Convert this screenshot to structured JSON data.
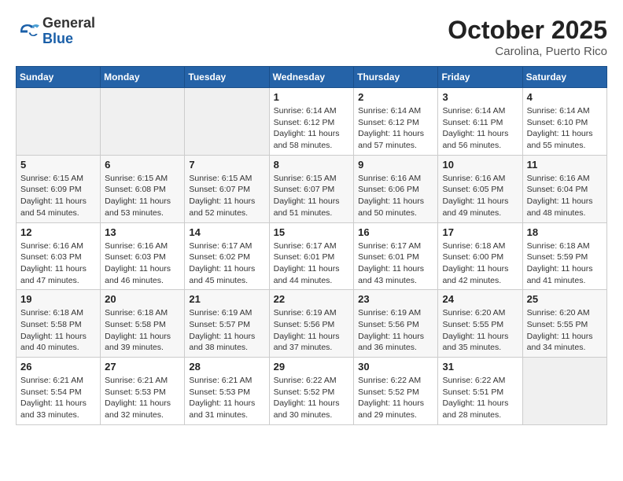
{
  "header": {
    "logo_general": "General",
    "logo_blue": "Blue",
    "month_title": "October 2025",
    "subtitle": "Carolina, Puerto Rico"
  },
  "days_of_week": [
    "Sunday",
    "Monday",
    "Tuesday",
    "Wednesday",
    "Thursday",
    "Friday",
    "Saturday"
  ],
  "weeks": [
    [
      {
        "day": "",
        "info": ""
      },
      {
        "day": "",
        "info": ""
      },
      {
        "day": "",
        "info": ""
      },
      {
        "day": "1",
        "info": "Sunrise: 6:14 AM\nSunset: 6:12 PM\nDaylight: 11 hours\nand 58 minutes."
      },
      {
        "day": "2",
        "info": "Sunrise: 6:14 AM\nSunset: 6:12 PM\nDaylight: 11 hours\nand 57 minutes."
      },
      {
        "day": "3",
        "info": "Sunrise: 6:14 AM\nSunset: 6:11 PM\nDaylight: 11 hours\nand 56 minutes."
      },
      {
        "day": "4",
        "info": "Sunrise: 6:14 AM\nSunset: 6:10 PM\nDaylight: 11 hours\nand 55 minutes."
      }
    ],
    [
      {
        "day": "5",
        "info": "Sunrise: 6:15 AM\nSunset: 6:09 PM\nDaylight: 11 hours\nand 54 minutes."
      },
      {
        "day": "6",
        "info": "Sunrise: 6:15 AM\nSunset: 6:08 PM\nDaylight: 11 hours\nand 53 minutes."
      },
      {
        "day": "7",
        "info": "Sunrise: 6:15 AM\nSunset: 6:07 PM\nDaylight: 11 hours\nand 52 minutes."
      },
      {
        "day": "8",
        "info": "Sunrise: 6:15 AM\nSunset: 6:07 PM\nDaylight: 11 hours\nand 51 minutes."
      },
      {
        "day": "9",
        "info": "Sunrise: 6:16 AM\nSunset: 6:06 PM\nDaylight: 11 hours\nand 50 minutes."
      },
      {
        "day": "10",
        "info": "Sunrise: 6:16 AM\nSunset: 6:05 PM\nDaylight: 11 hours\nand 49 minutes."
      },
      {
        "day": "11",
        "info": "Sunrise: 6:16 AM\nSunset: 6:04 PM\nDaylight: 11 hours\nand 48 minutes."
      }
    ],
    [
      {
        "day": "12",
        "info": "Sunrise: 6:16 AM\nSunset: 6:03 PM\nDaylight: 11 hours\nand 47 minutes."
      },
      {
        "day": "13",
        "info": "Sunrise: 6:16 AM\nSunset: 6:03 PM\nDaylight: 11 hours\nand 46 minutes."
      },
      {
        "day": "14",
        "info": "Sunrise: 6:17 AM\nSunset: 6:02 PM\nDaylight: 11 hours\nand 45 minutes."
      },
      {
        "day": "15",
        "info": "Sunrise: 6:17 AM\nSunset: 6:01 PM\nDaylight: 11 hours\nand 44 minutes."
      },
      {
        "day": "16",
        "info": "Sunrise: 6:17 AM\nSunset: 6:01 PM\nDaylight: 11 hours\nand 43 minutes."
      },
      {
        "day": "17",
        "info": "Sunrise: 6:18 AM\nSunset: 6:00 PM\nDaylight: 11 hours\nand 42 minutes."
      },
      {
        "day": "18",
        "info": "Sunrise: 6:18 AM\nSunset: 5:59 PM\nDaylight: 11 hours\nand 41 minutes."
      }
    ],
    [
      {
        "day": "19",
        "info": "Sunrise: 6:18 AM\nSunset: 5:58 PM\nDaylight: 11 hours\nand 40 minutes."
      },
      {
        "day": "20",
        "info": "Sunrise: 6:18 AM\nSunset: 5:58 PM\nDaylight: 11 hours\nand 39 minutes."
      },
      {
        "day": "21",
        "info": "Sunrise: 6:19 AM\nSunset: 5:57 PM\nDaylight: 11 hours\nand 38 minutes."
      },
      {
        "day": "22",
        "info": "Sunrise: 6:19 AM\nSunset: 5:56 PM\nDaylight: 11 hours\nand 37 minutes."
      },
      {
        "day": "23",
        "info": "Sunrise: 6:19 AM\nSunset: 5:56 PM\nDaylight: 11 hours\nand 36 minutes."
      },
      {
        "day": "24",
        "info": "Sunrise: 6:20 AM\nSunset: 5:55 PM\nDaylight: 11 hours\nand 35 minutes."
      },
      {
        "day": "25",
        "info": "Sunrise: 6:20 AM\nSunset: 5:55 PM\nDaylight: 11 hours\nand 34 minutes."
      }
    ],
    [
      {
        "day": "26",
        "info": "Sunrise: 6:21 AM\nSunset: 5:54 PM\nDaylight: 11 hours\nand 33 minutes."
      },
      {
        "day": "27",
        "info": "Sunrise: 6:21 AM\nSunset: 5:53 PM\nDaylight: 11 hours\nand 32 minutes."
      },
      {
        "day": "28",
        "info": "Sunrise: 6:21 AM\nSunset: 5:53 PM\nDaylight: 11 hours\nand 31 minutes."
      },
      {
        "day": "29",
        "info": "Sunrise: 6:22 AM\nSunset: 5:52 PM\nDaylight: 11 hours\nand 30 minutes."
      },
      {
        "day": "30",
        "info": "Sunrise: 6:22 AM\nSunset: 5:52 PM\nDaylight: 11 hours\nand 29 minutes."
      },
      {
        "day": "31",
        "info": "Sunrise: 6:22 AM\nSunset: 5:51 PM\nDaylight: 11 hours\nand 28 minutes."
      },
      {
        "day": "",
        "info": ""
      }
    ]
  ]
}
